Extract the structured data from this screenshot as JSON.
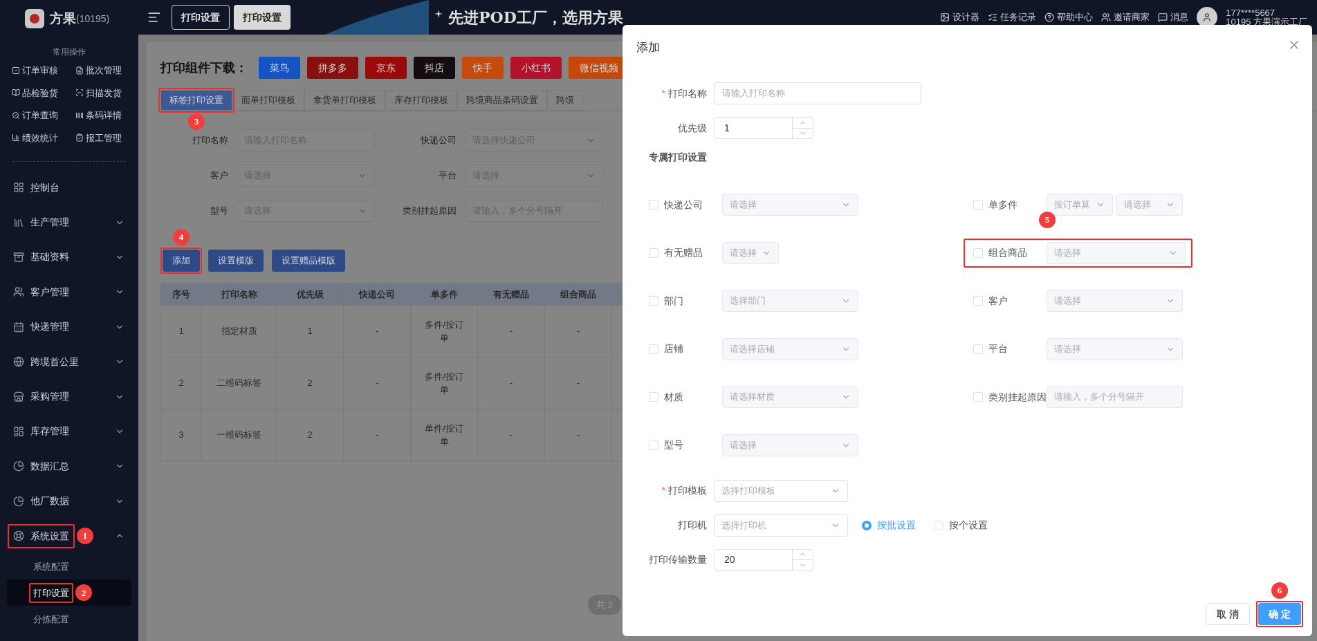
{
  "sidebar": {
    "logo_text": "方果",
    "logo_code": "(10195)",
    "quick_title": "常用操作",
    "quick_items": [
      {
        "label": "订单审核"
      },
      {
        "label": "批次管理"
      },
      {
        "label": "品检验货"
      },
      {
        "label": "扫描发货"
      },
      {
        "label": "订单查询"
      },
      {
        "label": "条码详情"
      },
      {
        "label": "绩效统计"
      },
      {
        "label": "报工管理"
      }
    ],
    "menu": [
      {
        "label": "控制台",
        "kind": "link"
      },
      {
        "label": "生产管理",
        "kind": "group",
        "expanded": false
      },
      {
        "label": "基础资料",
        "kind": "group",
        "expanded": false
      },
      {
        "label": "客户管理",
        "kind": "group",
        "expanded": false
      },
      {
        "label": "快递管理",
        "kind": "group",
        "expanded": false
      },
      {
        "label": "跨境首公里",
        "kind": "group",
        "expanded": false
      },
      {
        "label": "采购管理",
        "kind": "group",
        "expanded": false
      },
      {
        "label": "库存管理",
        "kind": "group",
        "expanded": false
      },
      {
        "label": "数据汇总",
        "kind": "group",
        "expanded": false
      },
      {
        "label": "他厂数据",
        "kind": "group",
        "expanded": false
      },
      {
        "label": "系统设置",
        "kind": "group",
        "expanded": true,
        "callout": "1",
        "children": [
          {
            "label": "系统配置",
            "selected": false
          },
          {
            "label": "打印设置",
            "selected": true,
            "callout": "2"
          },
          {
            "label": "分拣配置",
            "selected": false
          }
        ]
      }
    ]
  },
  "header": {
    "page_tabs": [
      {
        "label": "打印设置",
        "selected": false
      },
      {
        "label": "打印设置",
        "selected": true
      }
    ],
    "banner": "先进POD工厂，选用方果",
    "actions": [
      {
        "label": "设计器"
      },
      {
        "label": "任务记录"
      },
      {
        "label": "帮助中心"
      },
      {
        "label": "邀请商家"
      },
      {
        "label": "消息"
      }
    ],
    "user": {
      "phone": "177****5667",
      "company": "10195 方果演示工厂"
    }
  },
  "main": {
    "download_title": "打印组件下载：",
    "download_buttons": [
      {
        "label": "菜鸟",
        "color": "#1353c3"
      },
      {
        "label": "拼多多",
        "color": "#8a1010"
      },
      {
        "label": "京东",
        "color": "#9b0a0a"
      },
      {
        "label": "抖店",
        "color": "#140c10"
      },
      {
        "label": "快手",
        "color": "#c74a0b"
      },
      {
        "label": "小红书",
        "color": "#b3122a"
      },
      {
        "label": "微信视频",
        "color": "#c5480a"
      }
    ],
    "tabs": [
      {
        "label": "标签打印设置",
        "selected": true,
        "callout": "3"
      },
      {
        "label": "面单打印模板",
        "selected": false
      },
      {
        "label": "拿货单打印模板",
        "selected": false
      },
      {
        "label": "库存打印模板",
        "selected": false
      },
      {
        "label": "跨境商品条码设置",
        "selected": false
      },
      {
        "label": "跨境",
        "selected": false
      }
    ],
    "filters": [
      {
        "label": "打印名称",
        "kind": "input",
        "placeholder": "请输入打印名称"
      },
      {
        "label": "快递公司",
        "kind": "select",
        "placeholder": "请选择快递公司"
      },
      {
        "label": "客户",
        "kind": "select",
        "placeholder": "请选择"
      },
      {
        "label": "平台",
        "kind": "select",
        "placeholder": "请选择"
      },
      {
        "label": "型号",
        "kind": "select",
        "placeholder": "请选择"
      },
      {
        "label": "类别挂起原因",
        "kind": "input",
        "placeholder": "请输入，多个分号隔开"
      }
    ],
    "actions": [
      {
        "label": "添加",
        "callout": "4"
      },
      {
        "label": "设置模版"
      },
      {
        "label": "设置赠品模版"
      }
    ],
    "table": {
      "columns": [
        "序号",
        "打印名称",
        "优先级",
        "快递公司",
        "单多件",
        "有无赠品",
        "组合商品"
      ],
      "rows": [
        [
          "1",
          "指定材质",
          "1",
          "-",
          "多件/按订单",
          "-",
          "-"
        ],
        [
          "2",
          "二维码标签",
          "2",
          "-",
          "多件/按订单",
          "-",
          "-"
        ],
        [
          "3",
          "一维码标签",
          "2",
          "-",
          "单件/按订单",
          "-",
          "-"
        ]
      ]
    },
    "pagination": "共 3"
  },
  "dialog": {
    "title": "添加",
    "name_field": {
      "label": "打印名称",
      "required_mark": "*",
      "placeholder": "请输入打印名称"
    },
    "priority": {
      "label": "优先级",
      "value": "1"
    },
    "section_title": "专属打印设置",
    "conditions": [
      {
        "label": "快递公司",
        "checked": false,
        "kind": "select",
        "placeholders": [
          "请选择"
        ]
      },
      {
        "label": "有无赠品",
        "checked": false,
        "kind": "short_select",
        "placeholders": [
          "请选择"
        ]
      },
      {
        "label": "部门",
        "checked": false,
        "kind": "select",
        "placeholders": [
          "选择部门"
        ]
      },
      {
        "label": "店铺",
        "checked": false,
        "kind": "select",
        "placeholders": [
          "请选择店铺"
        ]
      },
      {
        "label": "材质",
        "checked": false,
        "kind": "select",
        "placeholders": [
          "请选择材质"
        ]
      },
      {
        "label": "型号",
        "checked": false,
        "kind": "select",
        "placeholders": [
          "请选择"
        ]
      },
      {
        "label": "单多件",
        "checked": false,
        "kind": "double_select",
        "placeholders": [
          "按订单算",
          "请选择"
        ]
      },
      {
        "label": "组合商品",
        "checked": false,
        "kind": "select",
        "placeholders": [
          "请选择"
        ],
        "callout": "5"
      },
      {
        "label": "客户",
        "checked": false,
        "kind": "select",
        "placeholders": [
          "请选择"
        ]
      },
      {
        "label": "平台",
        "checked": false,
        "kind": "select",
        "placeholders": [
          "请选择"
        ]
      },
      {
        "label": "类别挂起原因",
        "checked": false,
        "kind": "input",
        "placeholders": [
          "请输入，多个分号隔开"
        ]
      }
    ],
    "template": {
      "label": "打印模板",
      "required_mark": "*",
      "placeholder": "选择打印模板"
    },
    "printer": {
      "label": "打印机",
      "placeholder": "选择打印机",
      "options": [
        {
          "label": "按批设置",
          "selected": true
        },
        {
          "label": "按个设置",
          "selected": false
        }
      ]
    },
    "transfer": {
      "label": "打印传输数量",
      "value": "20"
    },
    "buttons": [
      {
        "label": "取 消",
        "kind": "secondary"
      },
      {
        "label": "确 定",
        "kind": "primary",
        "callout": "6"
      }
    ]
  }
}
